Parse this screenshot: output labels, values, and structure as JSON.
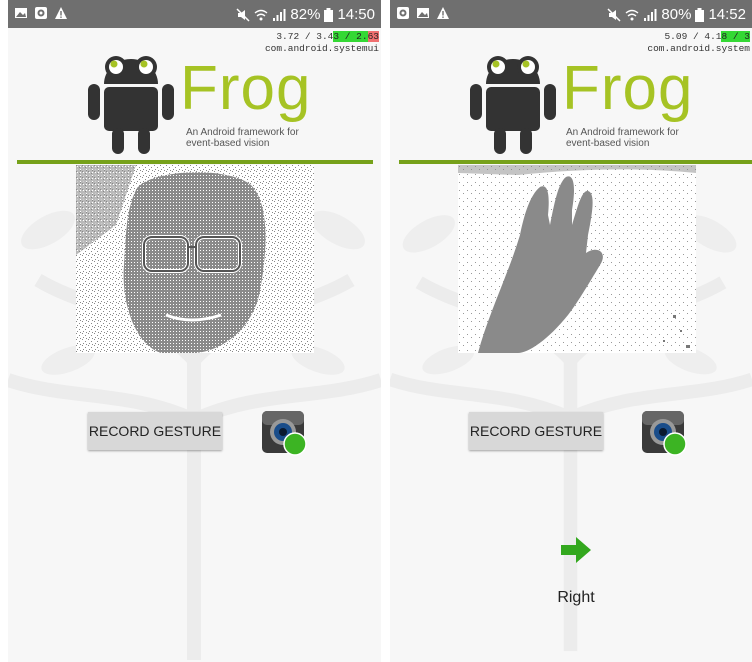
{
  "left": {
    "status": {
      "battery": "82%",
      "time": "14:50"
    },
    "overlay": {
      "line1_prefix": "3.72 / 3.4",
      "line1_mid": "3 / 2.",
      "line1_end": "63",
      "line2": "com.android.systemui"
    },
    "logo": {
      "title": "Frog",
      "subtitle_line1": "An Android framework for",
      "subtitle_line2": "event-based vision"
    },
    "record_button_label": "RECORD GESTURE",
    "gesture_label": ""
  },
  "right": {
    "status": {
      "battery": "80%",
      "time": "14:52"
    },
    "overlay": {
      "line1_prefix": "5.09 / 4.1",
      "line1_mid": "8 / 3",
      "line1_end": "",
      "line2": "com.android.system"
    },
    "logo": {
      "title": "Frog",
      "subtitle_line1": "An Android framework for",
      "subtitle_line2": "event-based vision"
    },
    "record_button_label": "RECORD GESTURE",
    "gesture_label": "Right"
  },
  "icons": [
    "image-icon",
    "camera-app-icon",
    "warning-icon",
    "mute-icon",
    "wifi-icon",
    "signal-icon",
    "battery-icon",
    "arrow-right-icon"
  ],
  "colors": {
    "brand_green": "#a6c324",
    "divider_green": "#76a11a",
    "status_bar": "#6f6f6f",
    "arrow_green": "#33a81e"
  }
}
